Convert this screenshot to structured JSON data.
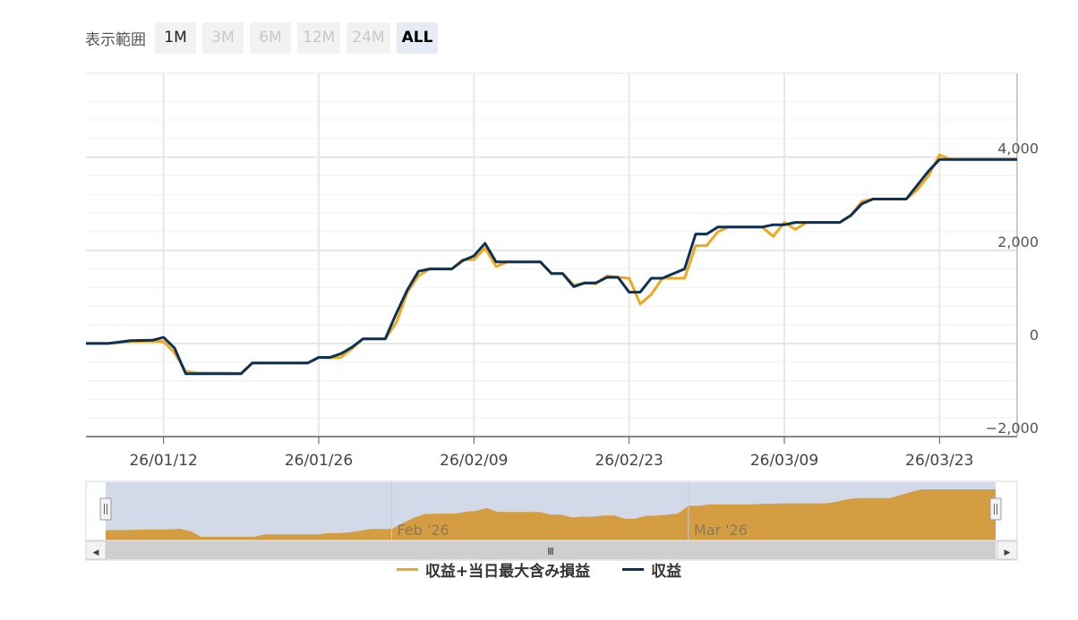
{
  "range_selector": {
    "label": "表示範囲",
    "buttons": [
      {
        "label": "1M",
        "state": "enabled"
      },
      {
        "label": "3M",
        "state": "disabled"
      },
      {
        "label": "6M",
        "state": "disabled"
      },
      {
        "label": "12M",
        "state": "disabled"
      },
      {
        "label": "24M",
        "state": "disabled"
      },
      {
        "label": "ALL",
        "state": "selected"
      }
    ]
  },
  "colors": {
    "series_orange": "#f2a81d",
    "series_navy": "#0c3156",
    "navigator_fill": "#d49d42",
    "navigator_mask": "#d2daea"
  },
  "chart_data": {
    "type": "line",
    "x_start": "2026-01-05",
    "x_end": "2026-03-30",
    "x_ticks": [
      "26/01/12",
      "26/01/26",
      "26/02/09",
      "26/02/23",
      "26/03/09",
      "26/03/23"
    ],
    "ylim": [
      -2000,
      5800
    ],
    "y_ticks": [
      "4,000",
      "2,000",
      "0",
      "−2,000"
    ],
    "y_tick_values": [
      4000,
      2000,
      0,
      -2000
    ],
    "grid": true,
    "legend_position": "bottom",
    "series": [
      {
        "name": "収益+当日最大含み損益",
        "color": "#f2a81d",
        "points": [
          [
            "2026-01-05",
            0
          ],
          [
            "2026-01-07",
            0
          ],
          [
            "2026-01-09",
            40
          ],
          [
            "2026-01-11",
            50
          ],
          [
            "2026-01-12",
            40
          ],
          [
            "2026-01-13",
            -200
          ],
          [
            "2026-01-14",
            -600
          ],
          [
            "2026-01-15",
            -630
          ],
          [
            "2026-01-19",
            -640
          ],
          [
            "2026-01-20",
            -420
          ],
          [
            "2026-01-22",
            -420
          ],
          [
            "2026-01-25",
            -420
          ],
          [
            "2026-01-26",
            -300
          ],
          [
            "2026-01-27",
            -310
          ],
          [
            "2026-01-28",
            -300
          ],
          [
            "2026-01-29",
            -110
          ],
          [
            "2026-01-30",
            100
          ],
          [
            "2026-02-01",
            100
          ],
          [
            "2026-02-02",
            450
          ],
          [
            "2026-02-03",
            1100
          ],
          [
            "2026-02-04",
            1450
          ],
          [
            "2026-02-05",
            1600
          ],
          [
            "2026-02-07",
            1600
          ],
          [
            "2026-02-08",
            1800
          ],
          [
            "2026-02-09",
            1800
          ],
          [
            "2026-02-10",
            2050
          ],
          [
            "2026-02-11",
            1650
          ],
          [
            "2026-02-12",
            1750
          ],
          [
            "2026-02-15",
            1750
          ],
          [
            "2026-02-16",
            1500
          ],
          [
            "2026-02-17",
            1500
          ],
          [
            "2026-02-18",
            1250
          ],
          [
            "2026-02-19",
            1300
          ],
          [
            "2026-02-20",
            1280
          ],
          [
            "2026-02-21",
            1450
          ],
          [
            "2026-02-22",
            1420
          ],
          [
            "2026-02-23",
            1400
          ],
          [
            "2026-02-24",
            850
          ],
          [
            "2026-02-25",
            1050
          ],
          [
            "2026-02-26",
            1400
          ],
          [
            "2026-02-28",
            1400
          ],
          [
            "2026-03-01",
            2100
          ],
          [
            "2026-03-02",
            2100
          ],
          [
            "2026-03-03",
            2400
          ],
          [
            "2026-03-04",
            2500
          ],
          [
            "2026-03-07",
            2500
          ],
          [
            "2026-03-08",
            2300
          ],
          [
            "2026-03-09",
            2600
          ],
          [
            "2026-03-10",
            2450
          ],
          [
            "2026-03-11",
            2600
          ],
          [
            "2026-03-14",
            2600
          ],
          [
            "2026-03-15",
            2750
          ],
          [
            "2026-03-16",
            3050
          ],
          [
            "2026-03-17",
            3100
          ],
          [
            "2026-03-19",
            3100
          ],
          [
            "2026-03-20",
            3100
          ],
          [
            "2026-03-21",
            3300
          ],
          [
            "2026-03-22",
            3600
          ],
          [
            "2026-03-23",
            4050
          ],
          [
            "2026-03-24",
            3950
          ],
          [
            "2026-03-27",
            3950
          ],
          [
            "2026-03-30",
            3950
          ]
        ]
      },
      {
        "name": "収益",
        "color": "#0c3156",
        "points": [
          [
            "2026-01-05",
            0
          ],
          [
            "2026-01-07",
            0
          ],
          [
            "2026-01-09",
            60
          ],
          [
            "2026-01-11",
            70
          ],
          [
            "2026-01-12",
            130
          ],
          [
            "2026-01-13",
            -100
          ],
          [
            "2026-01-14",
            -650
          ],
          [
            "2026-01-15",
            -650
          ],
          [
            "2026-01-19",
            -650
          ],
          [
            "2026-01-20",
            -420
          ],
          [
            "2026-01-22",
            -420
          ],
          [
            "2026-01-25",
            -420
          ],
          [
            "2026-01-26",
            -300
          ],
          [
            "2026-01-27",
            -300
          ],
          [
            "2026-01-28",
            -220
          ],
          [
            "2026-01-29",
            -80
          ],
          [
            "2026-01-30",
            100
          ],
          [
            "2026-02-01",
            100
          ],
          [
            "2026-02-02",
            650
          ],
          [
            "2026-02-03",
            1150
          ],
          [
            "2026-02-04",
            1550
          ],
          [
            "2026-02-05",
            1600
          ],
          [
            "2026-02-07",
            1600
          ],
          [
            "2026-02-08",
            1780
          ],
          [
            "2026-02-09",
            1880
          ],
          [
            "2026-02-10",
            2150
          ],
          [
            "2026-02-11",
            1750
          ],
          [
            "2026-02-12",
            1750
          ],
          [
            "2026-02-15",
            1750
          ],
          [
            "2026-02-16",
            1500
          ],
          [
            "2026-02-17",
            1500
          ],
          [
            "2026-02-18",
            1220
          ],
          [
            "2026-02-19",
            1300
          ],
          [
            "2026-02-20",
            1300
          ],
          [
            "2026-02-21",
            1420
          ],
          [
            "2026-02-22",
            1420
          ],
          [
            "2026-02-23",
            1100
          ],
          [
            "2026-02-24",
            1100
          ],
          [
            "2026-02-25",
            1400
          ],
          [
            "2026-02-26",
            1400
          ],
          [
            "2026-02-28",
            1600
          ],
          [
            "2026-03-01",
            2350
          ],
          [
            "2026-03-02",
            2350
          ],
          [
            "2026-03-03",
            2500
          ],
          [
            "2026-03-04",
            2500
          ],
          [
            "2026-03-07",
            2500
          ],
          [
            "2026-03-08",
            2550
          ],
          [
            "2026-03-09",
            2550
          ],
          [
            "2026-03-10",
            2600
          ],
          [
            "2026-03-11",
            2600
          ],
          [
            "2026-03-14",
            2600
          ],
          [
            "2026-03-15",
            2750
          ],
          [
            "2026-03-16",
            3000
          ],
          [
            "2026-03-17",
            3100
          ],
          [
            "2026-03-19",
            3100
          ],
          [
            "2026-03-20",
            3100
          ],
          [
            "2026-03-21",
            3400
          ],
          [
            "2026-03-22",
            3700
          ],
          [
            "2026-03-23",
            3950
          ],
          [
            "2026-03-24",
            3950
          ],
          [
            "2026-03-27",
            3950
          ],
          [
            "2026-03-30",
            3950
          ]
        ]
      }
    ],
    "navigator": {
      "labels": [
        "Feb '26",
        "Mar '26"
      ],
      "label_dates": [
        "2026-02-01",
        "2026-03-01"
      ],
      "handle_glyph": "Ⅲ",
      "scroll_left_glyph": "◀",
      "scroll_right_glyph": "▶"
    }
  }
}
